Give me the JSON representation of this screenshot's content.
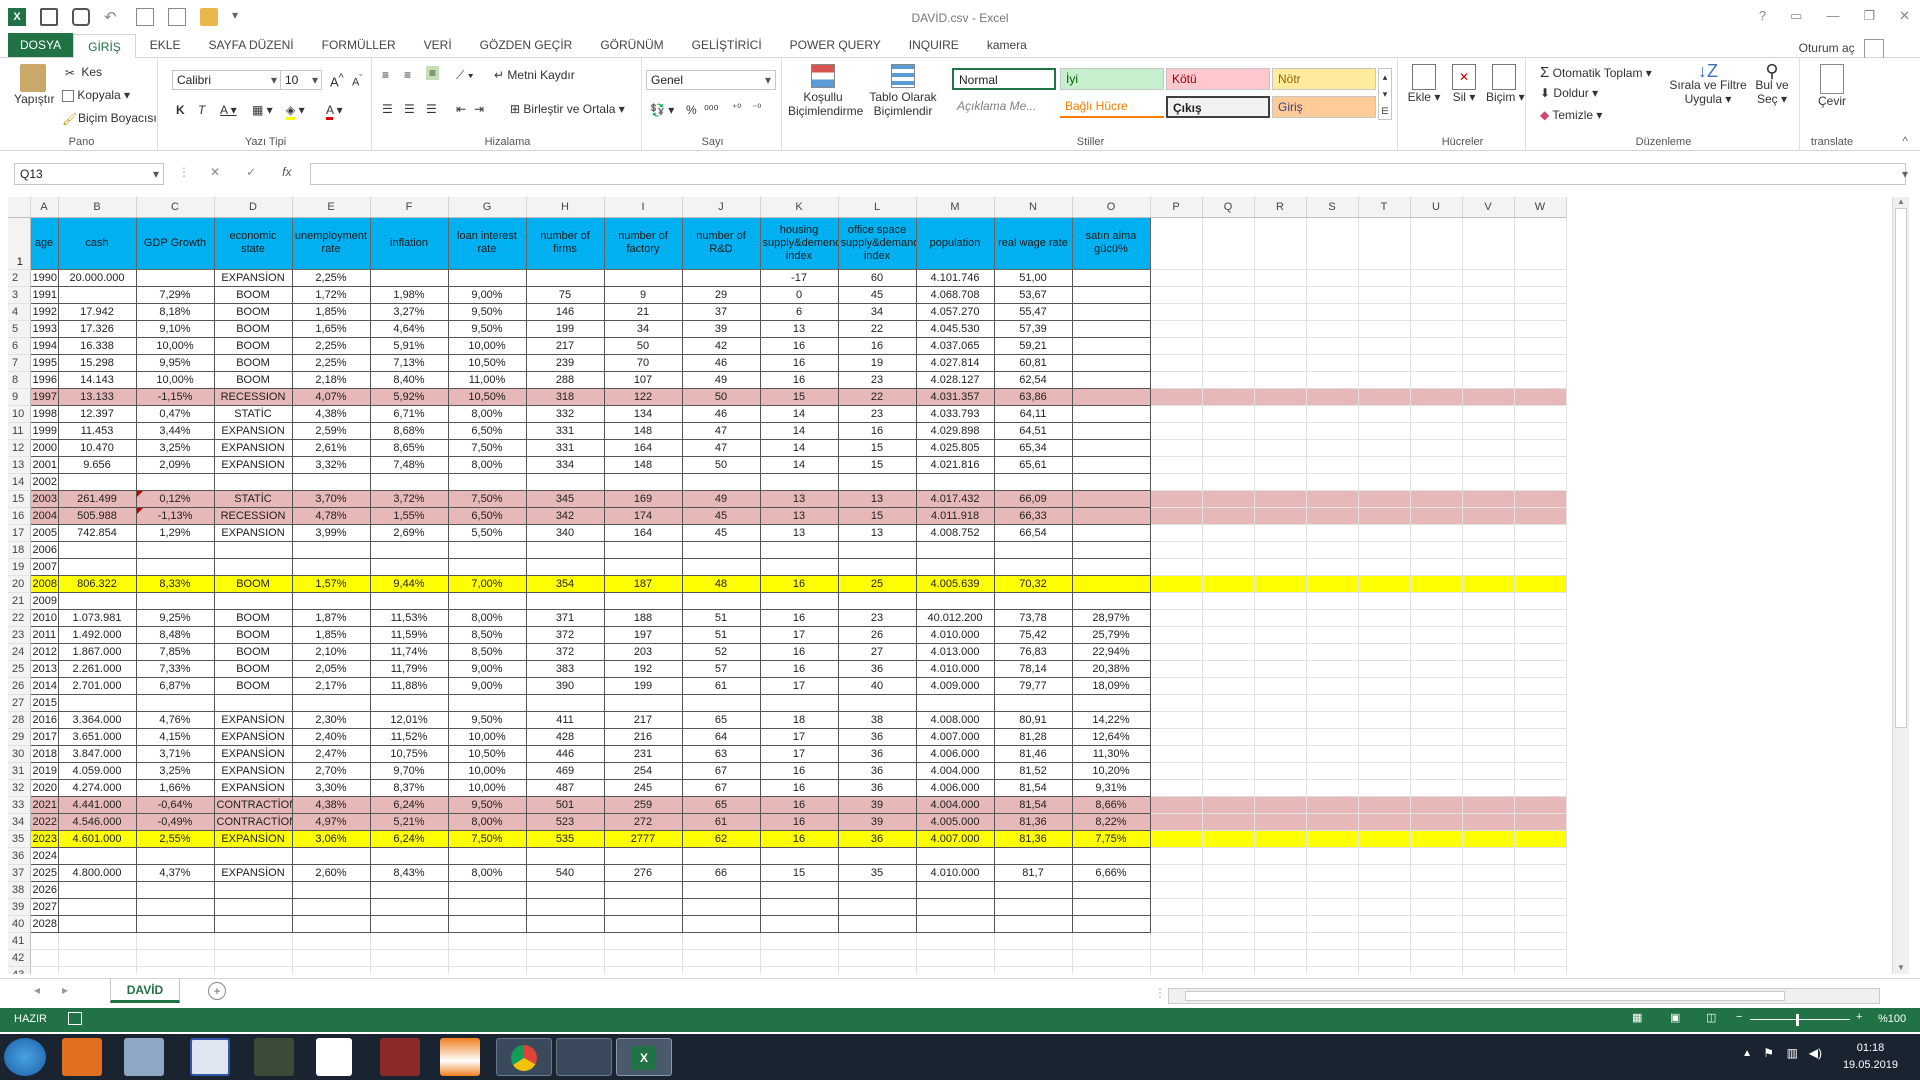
{
  "window": {
    "title": "DAVİD.csv - Excel",
    "signin": "Oturum aç"
  },
  "tabs": [
    "DOSYA",
    "GİRİŞ",
    "EKLE",
    "SAYFA DÜZENİ",
    "FORMÜLLER",
    "VERİ",
    "GÖZDEN GEÇİR",
    "GÖRÜNÜM",
    "GELİŞTİRİCİ",
    "POWER QUERY",
    "INQUIRE",
    "kamera"
  ],
  "ribbon": {
    "clipboard": {
      "paste": "Yapıştır",
      "cut": "Kes",
      "copy": "Kopyala",
      "format_painter": "Biçim Boyacısı",
      "label": "Pano"
    },
    "font": {
      "name": "Calibri",
      "size": "10",
      "label": "Yazı Tipi"
    },
    "align": {
      "wrap": "Metni Kaydır",
      "merge": "Birleştir ve Ortala",
      "label": "Hizalama"
    },
    "number": {
      "format": "Genel",
      "label": "Sayı"
    },
    "styles": {
      "cond": "Koşullu Biçimlendirme",
      "table": "Tablo Olarak Biçimlendir",
      "normal": "Normal",
      "good": "İyi",
      "bad": "Kötü",
      "neutral": "Nötr",
      "note": "Açıklama Me...",
      "linked": "Bağlı Hücre",
      "output": "Çıkış",
      "input": "Giriş",
      "label": "Stiller"
    },
    "cells": {
      "insert": "Ekle",
      "delete": "Sil",
      "format": "Biçim",
      "label": "Hücreler"
    },
    "editing": {
      "autosum": "Otomatik Toplam",
      "fill": "Doldur",
      "clear": "Temizle",
      "sort": "Sırala ve Filtre Uygula",
      "find": "Bul ve Seç",
      "label": "Düzenleme"
    },
    "translate": {
      "btn": "Çevir",
      "label": "translate"
    }
  },
  "formula_bar": {
    "namebox": "Q13",
    "value": ""
  },
  "columns": [
    "A",
    "B",
    "C",
    "D",
    "E",
    "F",
    "G",
    "H",
    "I",
    "J",
    "K",
    "L",
    "M",
    "N",
    "O",
    "P",
    "Q",
    "R",
    "S",
    "T",
    "U",
    "V",
    "W"
  ],
  "headers": [
    "age",
    "cash",
    "GDP Growth",
    "economic state",
    "unemployment rate",
    "inflation",
    "loan interest rate",
    "number of firms",
    "number of factory",
    "number of R&D",
    "housing supply&demend index",
    "office space supply&demand index",
    "population",
    "real wage rate",
    "satın alma gücü%"
  ],
  "rows": [
    {
      "n": "2",
      "style": "",
      "cells": [
        "1990",
        "20.000.000",
        "",
        "EXPANSİON",
        "2,25%",
        "",
        "",
        "",
        "",
        "",
        "-17",
        "60",
        "4.101.746",
        "51,00",
        ""
      ]
    },
    {
      "n": "3",
      "style": "",
      "cells": [
        "1991",
        "",
        "7,29%",
        "BOOM",
        "1,72%",
        "1,98%",
        "9,00%",
        "75",
        "9",
        "29",
        "0",
        "45",
        "4.068.708",
        "53,67",
        ""
      ]
    },
    {
      "n": "4",
      "style": "",
      "cells": [
        "1992",
        "17.942",
        "8,18%",
        "BOOM",
        "1,85%",
        "3,27%",
        "9,50%",
        "146",
        "21",
        "37",
        "6",
        "34",
        "4.057.270",
        "55,47",
        ""
      ]
    },
    {
      "n": "5",
      "style": "",
      "cells": [
        "1993",
        "17.326",
        "9,10%",
        "BOOM",
        "1,65%",
        "4,64%",
        "9,50%",
        "199",
        "34",
        "39",
        "13",
        "22",
        "4.045.530",
        "57,39",
        ""
      ]
    },
    {
      "n": "6",
      "style": "",
      "cells": [
        "1994",
        "16.338",
        "10,00%",
        "BOOM",
        "2,25%",
        "5,91%",
        "10,00%",
        "217",
        "50",
        "42",
        "16",
        "16",
        "4.037.065",
        "59,21",
        ""
      ]
    },
    {
      "n": "7",
      "style": "",
      "cells": [
        "1995",
        "15.298",
        "9,95%",
        "BOOM",
        "2,25%",
        "7,13%",
        "10,50%",
        "239",
        "70",
        "46",
        "16",
        "19",
        "4.027.814",
        "60,81",
        ""
      ]
    },
    {
      "n": "8",
      "style": "",
      "cells": [
        "1996",
        "14.143",
        "10,00%",
        "BOOM",
        "2,18%",
        "8,40%",
        "11,00%",
        "288",
        "107",
        "49",
        "16",
        "23",
        "4.028.127",
        "62,54",
        ""
      ]
    },
    {
      "n": "9",
      "style": "pink",
      "cells": [
        "1997",
        "13.133",
        "-1,15%",
        "RECESSION",
        "4,07%",
        "5,92%",
        "10,50%",
        "318",
        "122",
        "50",
        "15",
        "22",
        "4.031.357",
        "63,86",
        ""
      ]
    },
    {
      "n": "10",
      "style": "",
      "cells": [
        "1998",
        "12.397",
        "0,47%",
        "STATİC",
        "4,38%",
        "6,71%",
        "8,00%",
        "332",
        "134",
        "46",
        "14",
        "23",
        "4.033.793",
        "64,11",
        ""
      ]
    },
    {
      "n": "11",
      "style": "",
      "cells": [
        "1999",
        "11.453",
        "3,44%",
        "EXPANSION",
        "2,59%",
        "8,68%",
        "6,50%",
        "331",
        "148",
        "47",
        "14",
        "16",
        "4.029.898",
        "64,51",
        ""
      ]
    },
    {
      "n": "12",
      "style": "",
      "cells": [
        "2000",
        "10.470",
        "3,25%",
        "EXPANSION",
        "2,61%",
        "8,65%",
        "7,50%",
        "331",
        "164",
        "47",
        "14",
        "15",
        "4.025.805",
        "65,34",
        ""
      ]
    },
    {
      "n": "13",
      "style": "",
      "cells": [
        "2001",
        "9.656",
        "2,09%",
        "EXPANSION",
        "3,32%",
        "7,48%",
        "8,00%",
        "334",
        "148",
        "50",
        "14",
        "15",
        "4.021.816",
        "65,61",
        ""
      ]
    },
    {
      "n": "14",
      "style": "",
      "cells": [
        "2002",
        "",
        "",
        "",
        "",
        "",
        "",
        "",
        "",
        "",
        "",
        "",
        "",
        "",
        ""
      ]
    },
    {
      "n": "15",
      "style": "pink",
      "cells": [
        "2003",
        "261.499",
        "0,12%",
        "STATİC",
        "3,70%",
        "3,72%",
        "7,50%",
        "345",
        "169",
        "49",
        "13",
        "13",
        "4.017.432",
        "66,09",
        ""
      ]
    },
    {
      "n": "16",
      "style": "pink",
      "cells": [
        "2004",
        "505.988",
        "-1,13%",
        "RECESSION",
        "4,78%",
        "1,55%",
        "6,50%",
        "342",
        "174",
        "45",
        "13",
        "15",
        "4.011.918",
        "66,33",
        ""
      ]
    },
    {
      "n": "17",
      "style": "",
      "cells": [
        "2005",
        "742.854",
        "1,29%",
        "EXPANSION",
        "3,99%",
        "2,69%",
        "5,50%",
        "340",
        "164",
        "45",
        "13",
        "13",
        "4.008.752",
        "66,54",
        ""
      ]
    },
    {
      "n": "18",
      "style": "",
      "cells": [
        "2006",
        "",
        "",
        "",
        "",
        "",
        "",
        "",
        "",
        "",
        "",
        "",
        "",
        "",
        ""
      ]
    },
    {
      "n": "19",
      "style": "",
      "cells": [
        "2007",
        "",
        "",
        "",
        "",
        "",
        "",
        "",
        "",
        "",
        "",
        "",
        "",
        "",
        ""
      ]
    },
    {
      "n": "20",
      "style": "yellow",
      "cells": [
        "2008",
        "806.322",
        "8,33%",
        "BOOM",
        "1,57%",
        "9,44%",
        "7,00%",
        "354",
        "187",
        "48",
        "16",
        "25",
        "4.005.639",
        "70,32",
        ""
      ]
    },
    {
      "n": "21",
      "style": "",
      "cells": [
        "2009",
        "",
        "",
        "",
        "",
        "",
        "",
        "",
        "",
        "",
        "",
        "",
        "",
        "",
        ""
      ]
    },
    {
      "n": "22",
      "style": "",
      "cells": [
        "2010",
        "1.073.981",
        "9,25%",
        "BOOM",
        "1,87%",
        "11,53%",
        "8,00%",
        "371",
        "188",
        "51",
        "16",
        "23",
        "40.012.200",
        "73,78",
        "28,97%"
      ]
    },
    {
      "n": "23",
      "style": "",
      "cells": [
        "2011",
        "1.492.000",
        "8,48%",
        "BOOM",
        "1,85%",
        "11,59%",
        "8,50%",
        "372",
        "197",
        "51",
        "17",
        "26",
        "4.010.000",
        "75,42",
        "25,79%"
      ]
    },
    {
      "n": "24",
      "style": "",
      "cells": [
        "2012",
        "1.867.000",
        "7,85%",
        "BOOM",
        "2,10%",
        "11,74%",
        "8,50%",
        "372",
        "203",
        "52",
        "16",
        "27",
        "4.013.000",
        "76,83",
        "22,94%"
      ]
    },
    {
      "n": "25",
      "style": "",
      "cells": [
        "2013",
        "2.261.000",
        "7,33%",
        "BOOM",
        "2,05%",
        "11,79%",
        "9,00%",
        "383",
        "192",
        "57",
        "16",
        "36",
        "4.010.000",
        "78,14",
        "20,38%"
      ]
    },
    {
      "n": "26",
      "style": "",
      "cells": [
        "2014",
        "2.701.000",
        "6,87%",
        "BOOM",
        "2,17%",
        "11,88%",
        "9,00%",
        "390",
        "199",
        "61",
        "17",
        "40",
        "4.009.000",
        "79,77",
        "18,09%"
      ]
    },
    {
      "n": "27",
      "style": "",
      "cells": [
        "2015",
        "",
        "",
        "",
        "",
        "",
        "",
        "",
        "",
        "",
        "",
        "",
        "",
        "",
        ""
      ]
    },
    {
      "n": "28",
      "style": "",
      "cells": [
        "2016",
        "3.364.000",
        "4,76%",
        "EXPANSİON",
        "2,30%",
        "12,01%",
        "9,50%",
        "411",
        "217",
        "65",
        "18",
        "38",
        "4.008.000",
        "80,91",
        "14,22%"
      ]
    },
    {
      "n": "29",
      "style": "",
      "cells": [
        "2017",
        "3.651.000",
        "4,15%",
        "EXPANSİON",
        "2,40%",
        "11,52%",
        "10,00%",
        "428",
        "216",
        "64",
        "17",
        "36",
        "4.007.000",
        "81,28",
        "12,64%"
      ]
    },
    {
      "n": "30",
      "style": "",
      "cells": [
        "2018",
        "3.847.000",
        "3,71%",
        "EXPANSİON",
        "2,47%",
        "10,75%",
        "10,50%",
        "446",
        "231",
        "63",
        "17",
        "36",
        "4.006.000",
        "81,46",
        "11,30%"
      ]
    },
    {
      "n": "31",
      "style": "",
      "cells": [
        "2019",
        "4.059.000",
        "3,25%",
        "EXPANSİON",
        "2,70%",
        "9,70%",
        "10,00%",
        "469",
        "254",
        "67",
        "16",
        "36",
        "4.004.000",
        "81,52",
        "10,20%"
      ]
    },
    {
      "n": "32",
      "style": "",
      "cells": [
        "2020",
        "4.274.000",
        "1,66%",
        "EXPANSİON",
        "3,30%",
        "8,37%",
        "10,00%",
        "487",
        "245",
        "67",
        "16",
        "36",
        "4.006.000",
        "81,54",
        "9,31%"
      ]
    },
    {
      "n": "33",
      "style": "pink",
      "cells": [
        "2021",
        "4.441.000",
        "-0,64%",
        "CONTRACTİON",
        "4,38%",
        "6,24%",
        "9,50%",
        "501",
        "259",
        "65",
        "16",
        "39",
        "4.004.000",
        "81,54",
        "8,66%"
      ]
    },
    {
      "n": "34",
      "style": "pink",
      "cells": [
        "2022",
        "4.546.000",
        "-0,49%",
        "CONTRACTİON",
        "4,97%",
        "5,21%",
        "8,00%",
        "523",
        "272",
        "61",
        "16",
        "39",
        "4.005.000",
        "81,36",
        "8,22%"
      ]
    },
    {
      "n": "35",
      "style": "yellow",
      "cells": [
        "2023",
        "4.601.000",
        "2,55%",
        "EXPANSİON",
        "3,06%",
        "6,24%",
        "7,50%",
        "535",
        "2777",
        "62",
        "16",
        "36",
        "4.007.000",
        "81,36",
        "7,75%"
      ]
    },
    {
      "n": "36",
      "style": "",
      "cells": [
        "2024",
        "",
        "",
        "",
        "",
        "",
        "",
        "",
        "",
        "",
        "",
        "",
        "",
        "",
        ""
      ]
    },
    {
      "n": "37",
      "style": "",
      "cells": [
        "2025",
        "4.800.000",
        "4,37%",
        "EXPANSİON",
        "2,60%",
        "8,43%",
        "8,00%",
        "540",
        "276",
        "66",
        "15",
        "35",
        "4.010.000",
        "81,7",
        "6,66%"
      ]
    },
    {
      "n": "38",
      "style": "",
      "cells": [
        "2026",
        "",
        "",
        "",
        "",
        "",
        "",
        "",
        "",
        "",
        "",
        "",
        "",
        "",
        ""
      ]
    },
    {
      "n": "39",
      "style": "",
      "cells": [
        "2027",
        "",
        "",
        "",
        "",
        "",
        "",
        "",
        "",
        "",
        "",
        "",
        "",
        "",
        ""
      ]
    },
    {
      "n": "40",
      "style": "",
      "cells": [
        "2028",
        "",
        "",
        "",
        "",
        "",
        "",
        "",
        "",
        "",
        "",
        "",
        "",
        "",
        ""
      ]
    },
    {
      "n": "41",
      "style": "plain",
      "cells": []
    },
    {
      "n": "42",
      "style": "plain",
      "cells": []
    },
    {
      "n": "43",
      "style": "plain",
      "cells": []
    }
  ],
  "sheet_tab": "DAVİD",
  "status": {
    "mode": "HAZIR",
    "zoom": "%100"
  },
  "clock": {
    "time": "01:18",
    "date": "19.05.2019"
  },
  "colors": {
    "accent": "#217346",
    "header_fill": "#00b0f0",
    "pink_row": "#e6b8b7",
    "yellow_row": "#ffff00"
  }
}
